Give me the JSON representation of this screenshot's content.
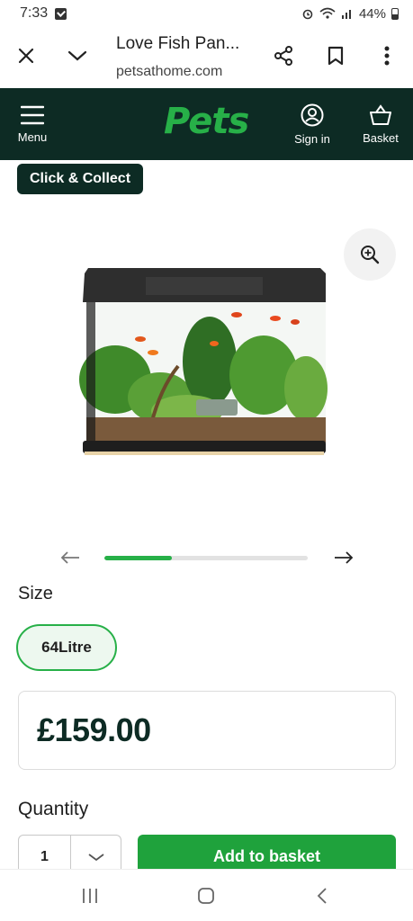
{
  "status_bar": {
    "time": "7:33",
    "battery": "44%"
  },
  "browser": {
    "title": "Love Fish Pan...",
    "url": "petsathome.com"
  },
  "header": {
    "menu_label": "Menu",
    "logo_text": "Pets",
    "signin_label": "Sign in",
    "basket_label": "Basket",
    "brand_color": "#0d2b24",
    "logo_color": "#27b048"
  },
  "badge": {
    "label": "Click & Collect"
  },
  "carousel": {
    "progress_fraction": 0.33
  },
  "size": {
    "label": "Size",
    "selected": "64Litre"
  },
  "price": {
    "value": "£159.00"
  },
  "quantity": {
    "label": "Quantity",
    "value": "1"
  },
  "add_button": {
    "label": "Add to basket",
    "color": "#1fa23c"
  },
  "icons": [
    "close-icon",
    "chevron-down-icon",
    "share-icon",
    "bookmark-icon",
    "more-vert-icon",
    "menu-icon",
    "account-icon",
    "basket-icon",
    "zoom-in-icon",
    "arrow-left-icon",
    "arrow-right-icon",
    "recents-icon",
    "home-icon",
    "back-icon"
  ]
}
